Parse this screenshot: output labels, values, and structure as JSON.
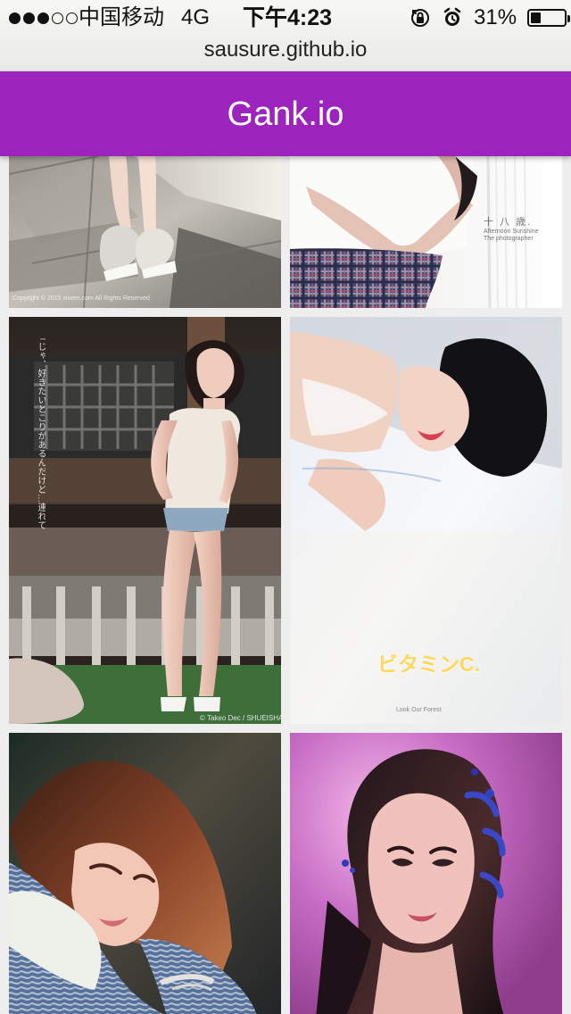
{
  "status_bar": {
    "signal_strength": 3,
    "signal_total": 5,
    "carrier": "中国移动",
    "network": "4G",
    "time": "下午4:23",
    "battery_percent": "31%",
    "battery_level": 0.31,
    "icons": [
      "signal-dots-icon",
      "orientation-lock-icon",
      "alarm-icon",
      "battery-icon"
    ]
  },
  "browser": {
    "url": "sausure.github.io"
  },
  "app": {
    "title": "Gank.io",
    "header_color": "#9d23bd",
    "background_color": "#eeeeee"
  },
  "gallery": {
    "items": [
      {
        "id": "photo-1",
        "watermark": "Copyright © 2015 xiuren.com All Rights Reserved"
      },
      {
        "id": "photo-2",
        "caption": "十 八 歳.",
        "subcaption": "Afternoon Sunshine",
        "small_text": "The photographer"
      },
      {
        "id": "photo-3",
        "vertical_text": "「じゃ、好きたいとこりがあるんだけど…連れてって」",
        "watermark": "© Takeo Dec / SHUEISHA"
      },
      {
        "id": "photo-4",
        "caption": "ビタミンC.",
        "credit": "Look Our Forest"
      },
      {
        "id": "photo-5"
      },
      {
        "id": "photo-6"
      }
    ]
  }
}
